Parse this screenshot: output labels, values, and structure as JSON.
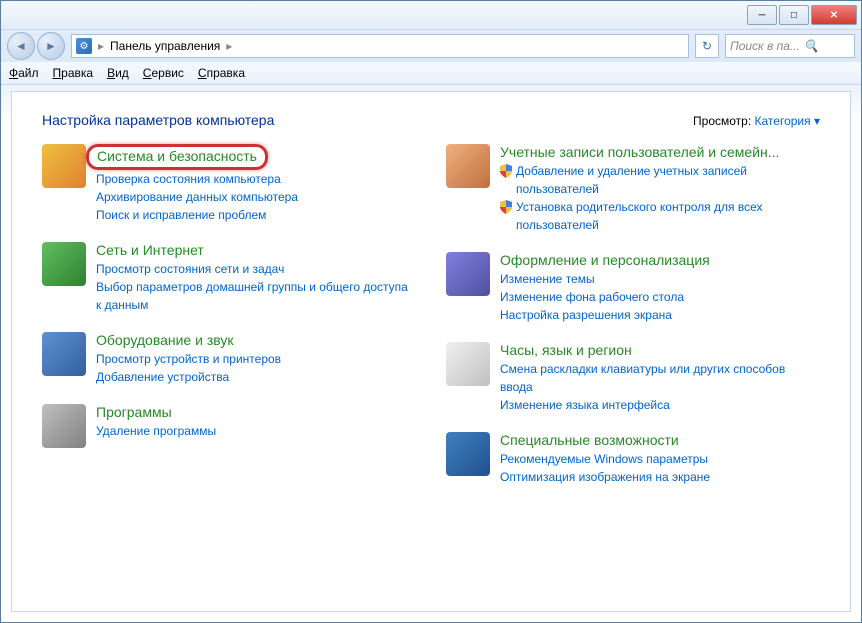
{
  "window": {
    "breadcrumb": "Панель управления",
    "search_placeholder": "Поиск в па...",
    "menus": [
      "Файл",
      "Правка",
      "Вид",
      "Сервис",
      "Справка"
    ]
  },
  "page": {
    "title": "Настройка параметров компьютера",
    "viewby_label": "Просмотр:",
    "viewby_value": "Категория"
  },
  "left": [
    {
      "title": "Система и безопасность",
      "iconClass": "ico-security",
      "highlight": true,
      "links": [
        {
          "text": "Проверка состояния компьютера"
        },
        {
          "text": "Архивирование данных компьютера"
        },
        {
          "text": "Поиск и исправление проблем"
        }
      ]
    },
    {
      "title": "Сеть и Интернет",
      "iconClass": "ico-network",
      "links": [
        {
          "text": "Просмотр состояния сети и задач"
        },
        {
          "text": "Выбор параметров домашней группы и общего доступа к данным"
        }
      ]
    },
    {
      "title": "Оборудование и звук",
      "iconClass": "ico-hardware",
      "links": [
        {
          "text": "Просмотр устройств и принтеров"
        },
        {
          "text": "Добавление устройства"
        }
      ]
    },
    {
      "title": "Программы",
      "iconClass": "ico-programs",
      "links": [
        {
          "text": "Удаление программы"
        }
      ]
    }
  ],
  "right": [
    {
      "title": "Учетные записи пользователей и семейн...",
      "iconClass": "ico-users",
      "links": [
        {
          "text": "Добавление и удаление учетных записей пользователей",
          "shield": true
        },
        {
          "text": "Установка родительского контроля для всех пользователей",
          "shield": true
        }
      ]
    },
    {
      "title": "Оформление и персонализация",
      "iconClass": "ico-appearance",
      "links": [
        {
          "text": "Изменение темы"
        },
        {
          "text": "Изменение фона рабочего стола"
        },
        {
          "text": "Настройка разрешения экрана"
        }
      ]
    },
    {
      "title": "Часы, язык и регион",
      "iconClass": "ico-clock",
      "links": [
        {
          "text": "Смена раскладки клавиатуры или других способов ввода"
        },
        {
          "text": "Изменение языка интерфейса"
        }
      ]
    },
    {
      "title": "Специальные возможности",
      "iconClass": "ico-access",
      "links": [
        {
          "text": "Рекомендуемые Windows параметры"
        },
        {
          "text": "Оптимизация изображения на экране"
        }
      ]
    }
  ]
}
